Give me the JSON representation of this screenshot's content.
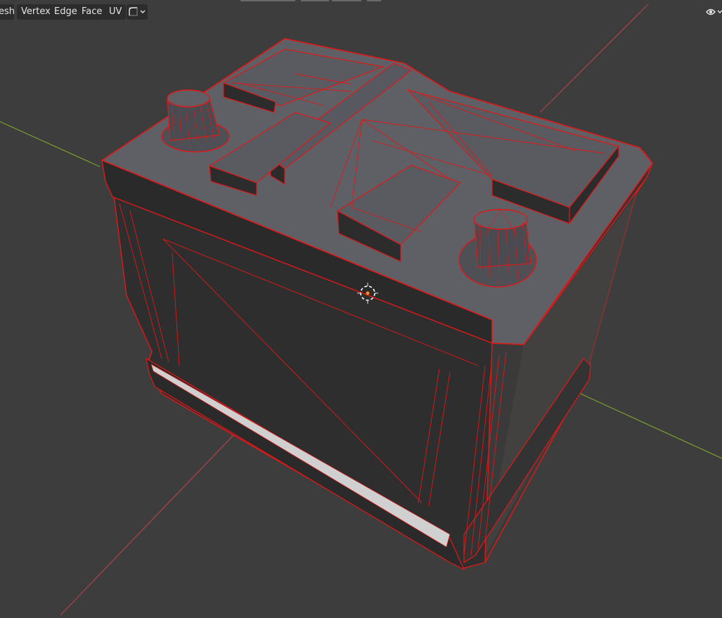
{
  "header_menu": {
    "items": [
      {
        "key": "mesh",
        "label": "esh"
      },
      {
        "key": "vertex",
        "label": "Vertex"
      },
      {
        "key": "edge",
        "label": "Edge"
      },
      {
        "key": "face",
        "label": "Face"
      },
      {
        "key": "uv",
        "label": "UV"
      }
    ]
  },
  "header_icons": {
    "select_mode": "edge-select-mode-icon",
    "visibility": "eye-visibility-icon"
  },
  "viewport": {
    "background": "#3d3d3d",
    "x_axis_color": "#b0424a",
    "y_axis_color": "#7aa02e",
    "wire_color": "#e01818",
    "face_top_color": "#5f6065",
    "face_side_color": "#2e2e2e",
    "origin_icon": "3d-cursor-icon"
  }
}
